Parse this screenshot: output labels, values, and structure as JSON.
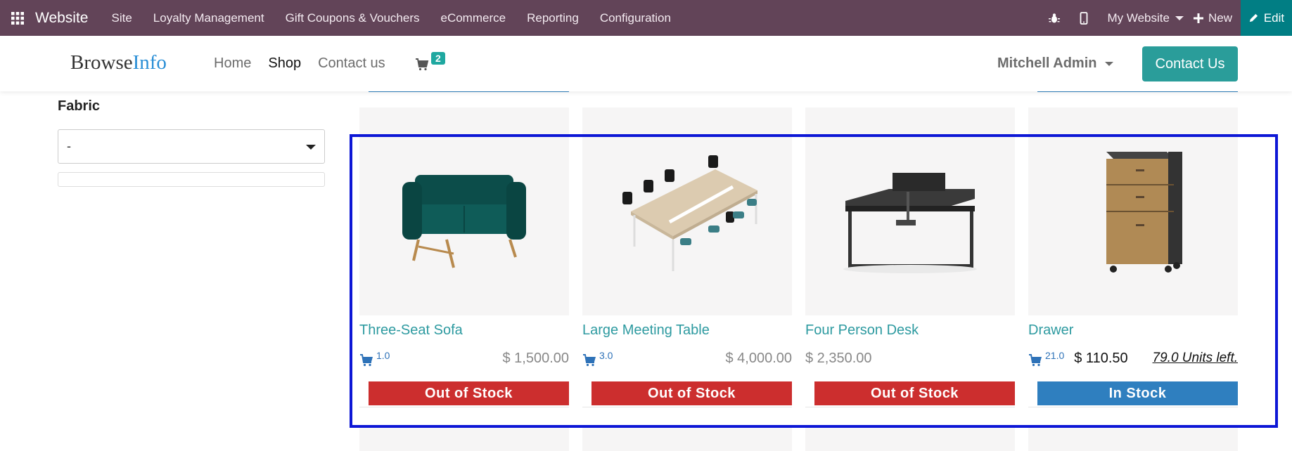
{
  "topbar": {
    "brand": "Website",
    "menu": [
      "Site",
      "Loyalty Management",
      "Gift Coupons & Vouchers",
      "eCommerce",
      "Reporting",
      "Configuration"
    ],
    "website_selector": "My Website",
    "new_label": "New",
    "edit_label": "Edit"
  },
  "header": {
    "logo_browse": "Browse",
    "logo_info": "Info",
    "nav": [
      "Home",
      "Shop",
      "Contact us"
    ],
    "active_nav": "Shop",
    "cart_count": "2",
    "user": "Mitchell Admin",
    "contact_button": "Contact Us"
  },
  "sidebar": {
    "filter_title": "Fabric",
    "fabric_value": "-"
  },
  "products": [
    {
      "name": "Three-Seat Sofa",
      "qty": "1.0",
      "price": "$ 1,500.00",
      "units_left": "",
      "stock": "Out of Stock",
      "in_stock": false
    },
    {
      "name": "Large Meeting Table",
      "qty": "3.0",
      "price": "$ 4,000.00",
      "units_left": "",
      "stock": "Out of Stock",
      "in_stock": false
    },
    {
      "name": "Four Person Desk",
      "qty": "",
      "price": "$ 2,350.00",
      "units_left": "",
      "stock": "Out of Stock",
      "in_stock": false
    },
    {
      "name": "Drawer",
      "qty": "21.0",
      "price": "$ 110.50",
      "units_left": "79.0 Units left.",
      "stock": "In Stock",
      "in_stock": true
    }
  ],
  "colors": {
    "topbar": "#624458",
    "edit": "#017e84",
    "accent": "#2d9aa0",
    "out_of_stock": "#cc2e2e",
    "in_stock": "#2f7fbf",
    "highlight": "#0d17d6"
  },
  "icons": [
    "apps-grid-icon",
    "bug-icon",
    "mobile-icon",
    "plus-icon",
    "pencil-icon",
    "cart-icon",
    "chevron-down-icon"
  ]
}
